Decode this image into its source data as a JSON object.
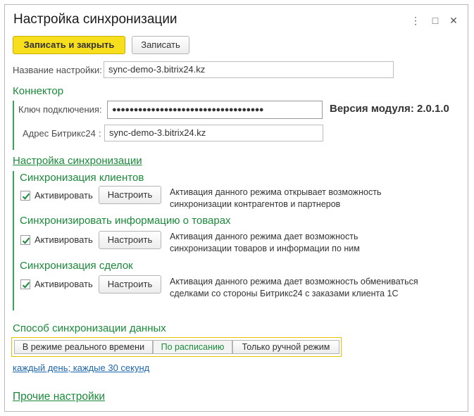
{
  "window": {
    "title": "Настройка синхронизации",
    "more_icon": "⋮",
    "maximize_icon": "□",
    "close_icon": "✕"
  },
  "toolbar": {
    "save_close_label": "Записать и закрыть",
    "save_label": "Записать"
  },
  "setting_name": {
    "label": "Название настройки:",
    "value": "sync-demo-3.bitrix24.kz"
  },
  "connector": {
    "title": "Коннектор",
    "key_label": "Ключ подключения:",
    "key_value": "●●●●●●●●●●●●●●●●●●●●●●●●●●●●●●●●●●●",
    "version_text": "Версия модуля: 2.0.1.0",
    "address_label": "Адрес Битрикс24",
    "address_colon": ":",
    "address_value": "sync-demo-3.bitrix24.kz"
  },
  "sync_settings": {
    "title": "Настройка синхронизации",
    "sections": [
      {
        "title": "Синхронизация клиентов",
        "activate_label": "Активировать",
        "activated": true,
        "configure_label": "Настроить",
        "description": "Активация данного режима открывает возможность синхронизации контрагентов и партнеров"
      },
      {
        "title": "Синхронизировать информацию о товарах",
        "activate_label": "Активировать",
        "activated": true,
        "configure_label": "Настроить",
        "description": "Активация данного режима дает возможность синхронизации товаров и информации по ним"
      },
      {
        "title": "Синхронизация сделок",
        "activate_label": "Активировать",
        "activated": true,
        "configure_label": "Настроить",
        "description": "Активация данного режима дает возможность обмениваться сделками со стороны Битрикс24 с заказами клиента 1С"
      }
    ]
  },
  "sync_method": {
    "title": "Способ синхронизации данных",
    "options": [
      "В режиме реального времени",
      "По расписанию",
      "Только ручной режим"
    ],
    "selected": "По расписанию",
    "schedule_link": "каждый день; каждые 30 секунд"
  },
  "other_settings": {
    "title": "Прочие настройки"
  },
  "colors": {
    "accent_green": "#1a8a3a",
    "primary_button": "#f7df1e",
    "link_blue": "#1d66b0"
  }
}
